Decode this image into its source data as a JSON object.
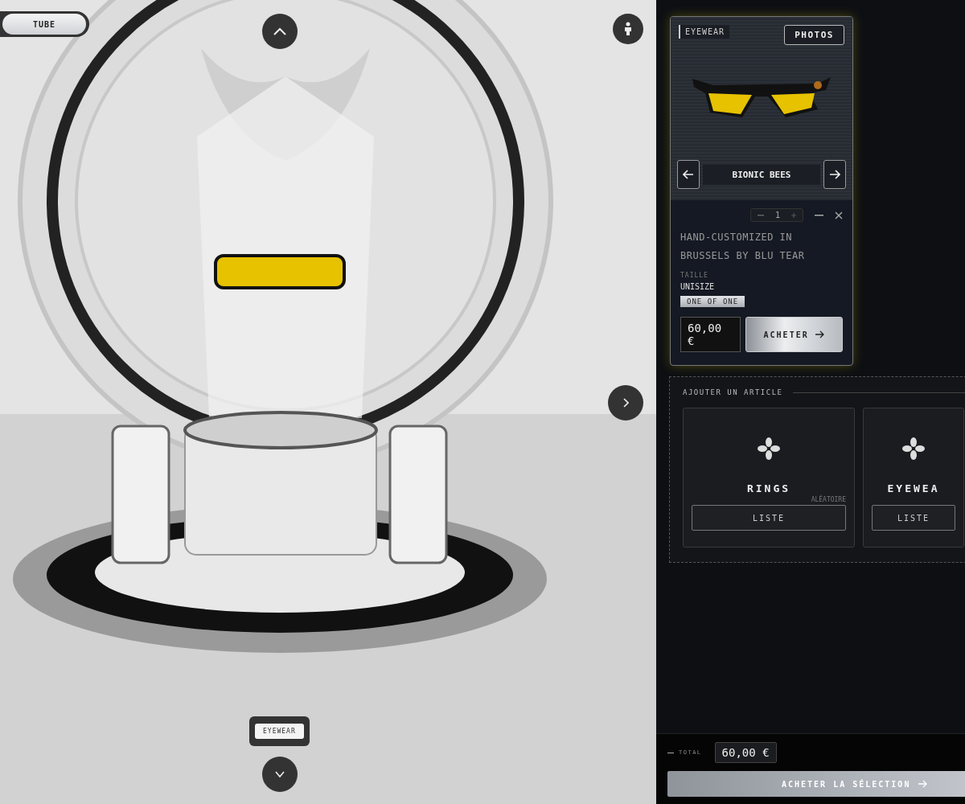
{
  "scene": {
    "mode_pill": "TUBE",
    "category_label": "EYEWEAR"
  },
  "product": {
    "category": "EYEWEAR",
    "photos_button": "PHOTOS",
    "name": "BIONIC BEES",
    "quantity": "1",
    "description": "HAND-CUSTOMIZED IN BRUSSELS BY BLU TEAR",
    "size_label": "TAILLE",
    "size_value": "UNISIZE",
    "badge": "ONE OF ONE",
    "price": "60,00 €",
    "buy_button": "ACHETER"
  },
  "add_article": {
    "title": "AJOUTER UN ARTICLE",
    "cards": [
      {
        "name": "RINGS",
        "note": "ALÉATOIRE",
        "button": "LISTE"
      },
      {
        "name": "EYEWEA",
        "button": "LISTE"
      }
    ]
  },
  "footer": {
    "total_label": "TOTAL",
    "total": "60,00 €",
    "checkout_button": "ACHETER LA SÉLECTION"
  }
}
